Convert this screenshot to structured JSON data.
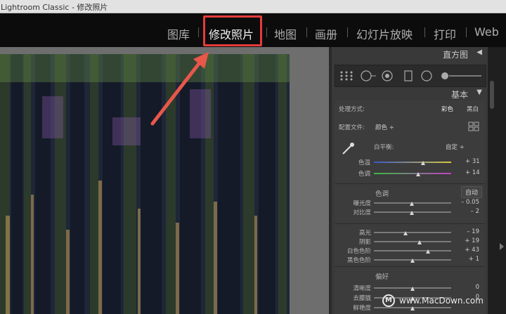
{
  "window": {
    "title": "Lightroom Classic - 修改照片"
  },
  "modules": [
    {
      "label": "图库"
    },
    {
      "label": "修改照片"
    },
    {
      "label": "地图"
    },
    {
      "label": "画册"
    },
    {
      "label": "幻灯片放映"
    },
    {
      "label": "打印"
    },
    {
      "label": "Web"
    }
  ],
  "panel": {
    "histogram_title": "直方图",
    "basic_title": "基本",
    "treatment_label": "处理方式:",
    "treatment_color": "彩色",
    "treatment_bw": "黑白",
    "profile_label": "配置文件:",
    "profile_value": "颜色 ÷",
    "wb_label": "白平衡:",
    "wb_value": "自定 ÷",
    "temp": {
      "label": "色温",
      "value": "+ 31",
      "pos": 0.64
    },
    "tint": {
      "label": "色调",
      "value": "+ 14",
      "pos": 0.57
    },
    "tone_title": "色调",
    "auto_label": "自动",
    "tone_sliders": [
      {
        "label": "曝光度",
        "value": "– 0.05",
        "pos": 0.49
      },
      {
        "label": "对比度",
        "value": "– 2",
        "pos": 0.49
      }
    ],
    "light_sliders": [
      {
        "label": "高光",
        "value": "– 19",
        "pos": 0.41
      },
      {
        "label": "阴影",
        "value": "+ 19",
        "pos": 0.59
      },
      {
        "label": "白色色阶",
        "value": "+ 43",
        "pos": 0.7
      },
      {
        "label": "黑色色阶",
        "value": "+ 1",
        "pos": 0.5
      }
    ],
    "presence_title": "偏好",
    "presence_sliders": [
      {
        "label": "清晰度",
        "value": "0",
        "pos": 0.5
      },
      {
        "label": "去朦胧",
        "value": "0",
        "pos": 0.5
      },
      {
        "label": "鲜艳度",
        "value": "",
        "pos": 0.5
      }
    ]
  },
  "watermark": {
    "text": "www.MacDown.com",
    "logo_letter": "M"
  },
  "colors": {
    "highlight": "#e53b3b",
    "panel_bg": "#393939"
  }
}
